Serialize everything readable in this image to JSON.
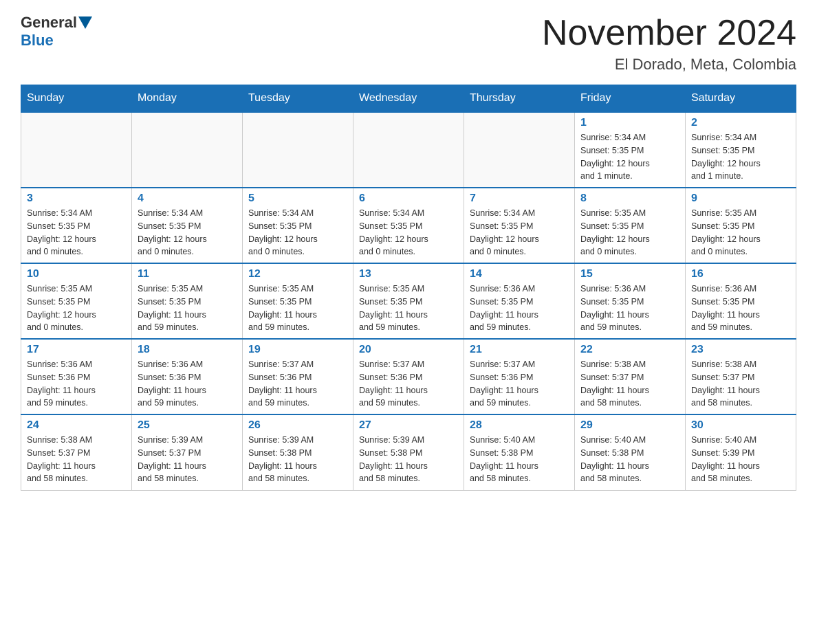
{
  "header": {
    "logo": {
      "general": "General",
      "blue": "Blue"
    },
    "title": "November 2024",
    "location": "El Dorado, Meta, Colombia"
  },
  "weekdays": [
    "Sunday",
    "Monday",
    "Tuesday",
    "Wednesday",
    "Thursday",
    "Friday",
    "Saturday"
  ],
  "weeks": [
    {
      "days": [
        {
          "num": "",
          "info": ""
        },
        {
          "num": "",
          "info": ""
        },
        {
          "num": "",
          "info": ""
        },
        {
          "num": "",
          "info": ""
        },
        {
          "num": "",
          "info": ""
        },
        {
          "num": "1",
          "info": "Sunrise: 5:34 AM\nSunset: 5:35 PM\nDaylight: 12 hours\nand 1 minute."
        },
        {
          "num": "2",
          "info": "Sunrise: 5:34 AM\nSunset: 5:35 PM\nDaylight: 12 hours\nand 1 minute."
        }
      ]
    },
    {
      "days": [
        {
          "num": "3",
          "info": "Sunrise: 5:34 AM\nSunset: 5:35 PM\nDaylight: 12 hours\nand 0 minutes."
        },
        {
          "num": "4",
          "info": "Sunrise: 5:34 AM\nSunset: 5:35 PM\nDaylight: 12 hours\nand 0 minutes."
        },
        {
          "num": "5",
          "info": "Sunrise: 5:34 AM\nSunset: 5:35 PM\nDaylight: 12 hours\nand 0 minutes."
        },
        {
          "num": "6",
          "info": "Sunrise: 5:34 AM\nSunset: 5:35 PM\nDaylight: 12 hours\nand 0 minutes."
        },
        {
          "num": "7",
          "info": "Sunrise: 5:34 AM\nSunset: 5:35 PM\nDaylight: 12 hours\nand 0 minutes."
        },
        {
          "num": "8",
          "info": "Sunrise: 5:35 AM\nSunset: 5:35 PM\nDaylight: 12 hours\nand 0 minutes."
        },
        {
          "num": "9",
          "info": "Sunrise: 5:35 AM\nSunset: 5:35 PM\nDaylight: 12 hours\nand 0 minutes."
        }
      ]
    },
    {
      "days": [
        {
          "num": "10",
          "info": "Sunrise: 5:35 AM\nSunset: 5:35 PM\nDaylight: 12 hours\nand 0 minutes."
        },
        {
          "num": "11",
          "info": "Sunrise: 5:35 AM\nSunset: 5:35 PM\nDaylight: 11 hours\nand 59 minutes."
        },
        {
          "num": "12",
          "info": "Sunrise: 5:35 AM\nSunset: 5:35 PM\nDaylight: 11 hours\nand 59 minutes."
        },
        {
          "num": "13",
          "info": "Sunrise: 5:35 AM\nSunset: 5:35 PM\nDaylight: 11 hours\nand 59 minutes."
        },
        {
          "num": "14",
          "info": "Sunrise: 5:36 AM\nSunset: 5:35 PM\nDaylight: 11 hours\nand 59 minutes."
        },
        {
          "num": "15",
          "info": "Sunrise: 5:36 AM\nSunset: 5:35 PM\nDaylight: 11 hours\nand 59 minutes."
        },
        {
          "num": "16",
          "info": "Sunrise: 5:36 AM\nSunset: 5:35 PM\nDaylight: 11 hours\nand 59 minutes."
        }
      ]
    },
    {
      "days": [
        {
          "num": "17",
          "info": "Sunrise: 5:36 AM\nSunset: 5:36 PM\nDaylight: 11 hours\nand 59 minutes."
        },
        {
          "num": "18",
          "info": "Sunrise: 5:36 AM\nSunset: 5:36 PM\nDaylight: 11 hours\nand 59 minutes."
        },
        {
          "num": "19",
          "info": "Sunrise: 5:37 AM\nSunset: 5:36 PM\nDaylight: 11 hours\nand 59 minutes."
        },
        {
          "num": "20",
          "info": "Sunrise: 5:37 AM\nSunset: 5:36 PM\nDaylight: 11 hours\nand 59 minutes."
        },
        {
          "num": "21",
          "info": "Sunrise: 5:37 AM\nSunset: 5:36 PM\nDaylight: 11 hours\nand 59 minutes."
        },
        {
          "num": "22",
          "info": "Sunrise: 5:38 AM\nSunset: 5:37 PM\nDaylight: 11 hours\nand 58 minutes."
        },
        {
          "num": "23",
          "info": "Sunrise: 5:38 AM\nSunset: 5:37 PM\nDaylight: 11 hours\nand 58 minutes."
        }
      ]
    },
    {
      "days": [
        {
          "num": "24",
          "info": "Sunrise: 5:38 AM\nSunset: 5:37 PM\nDaylight: 11 hours\nand 58 minutes."
        },
        {
          "num": "25",
          "info": "Sunrise: 5:39 AM\nSunset: 5:37 PM\nDaylight: 11 hours\nand 58 minutes."
        },
        {
          "num": "26",
          "info": "Sunrise: 5:39 AM\nSunset: 5:38 PM\nDaylight: 11 hours\nand 58 minutes."
        },
        {
          "num": "27",
          "info": "Sunrise: 5:39 AM\nSunset: 5:38 PM\nDaylight: 11 hours\nand 58 minutes."
        },
        {
          "num": "28",
          "info": "Sunrise: 5:40 AM\nSunset: 5:38 PM\nDaylight: 11 hours\nand 58 minutes."
        },
        {
          "num": "29",
          "info": "Sunrise: 5:40 AM\nSunset: 5:38 PM\nDaylight: 11 hours\nand 58 minutes."
        },
        {
          "num": "30",
          "info": "Sunrise: 5:40 AM\nSunset: 5:39 PM\nDaylight: 11 hours\nand 58 minutes."
        }
      ]
    }
  ]
}
